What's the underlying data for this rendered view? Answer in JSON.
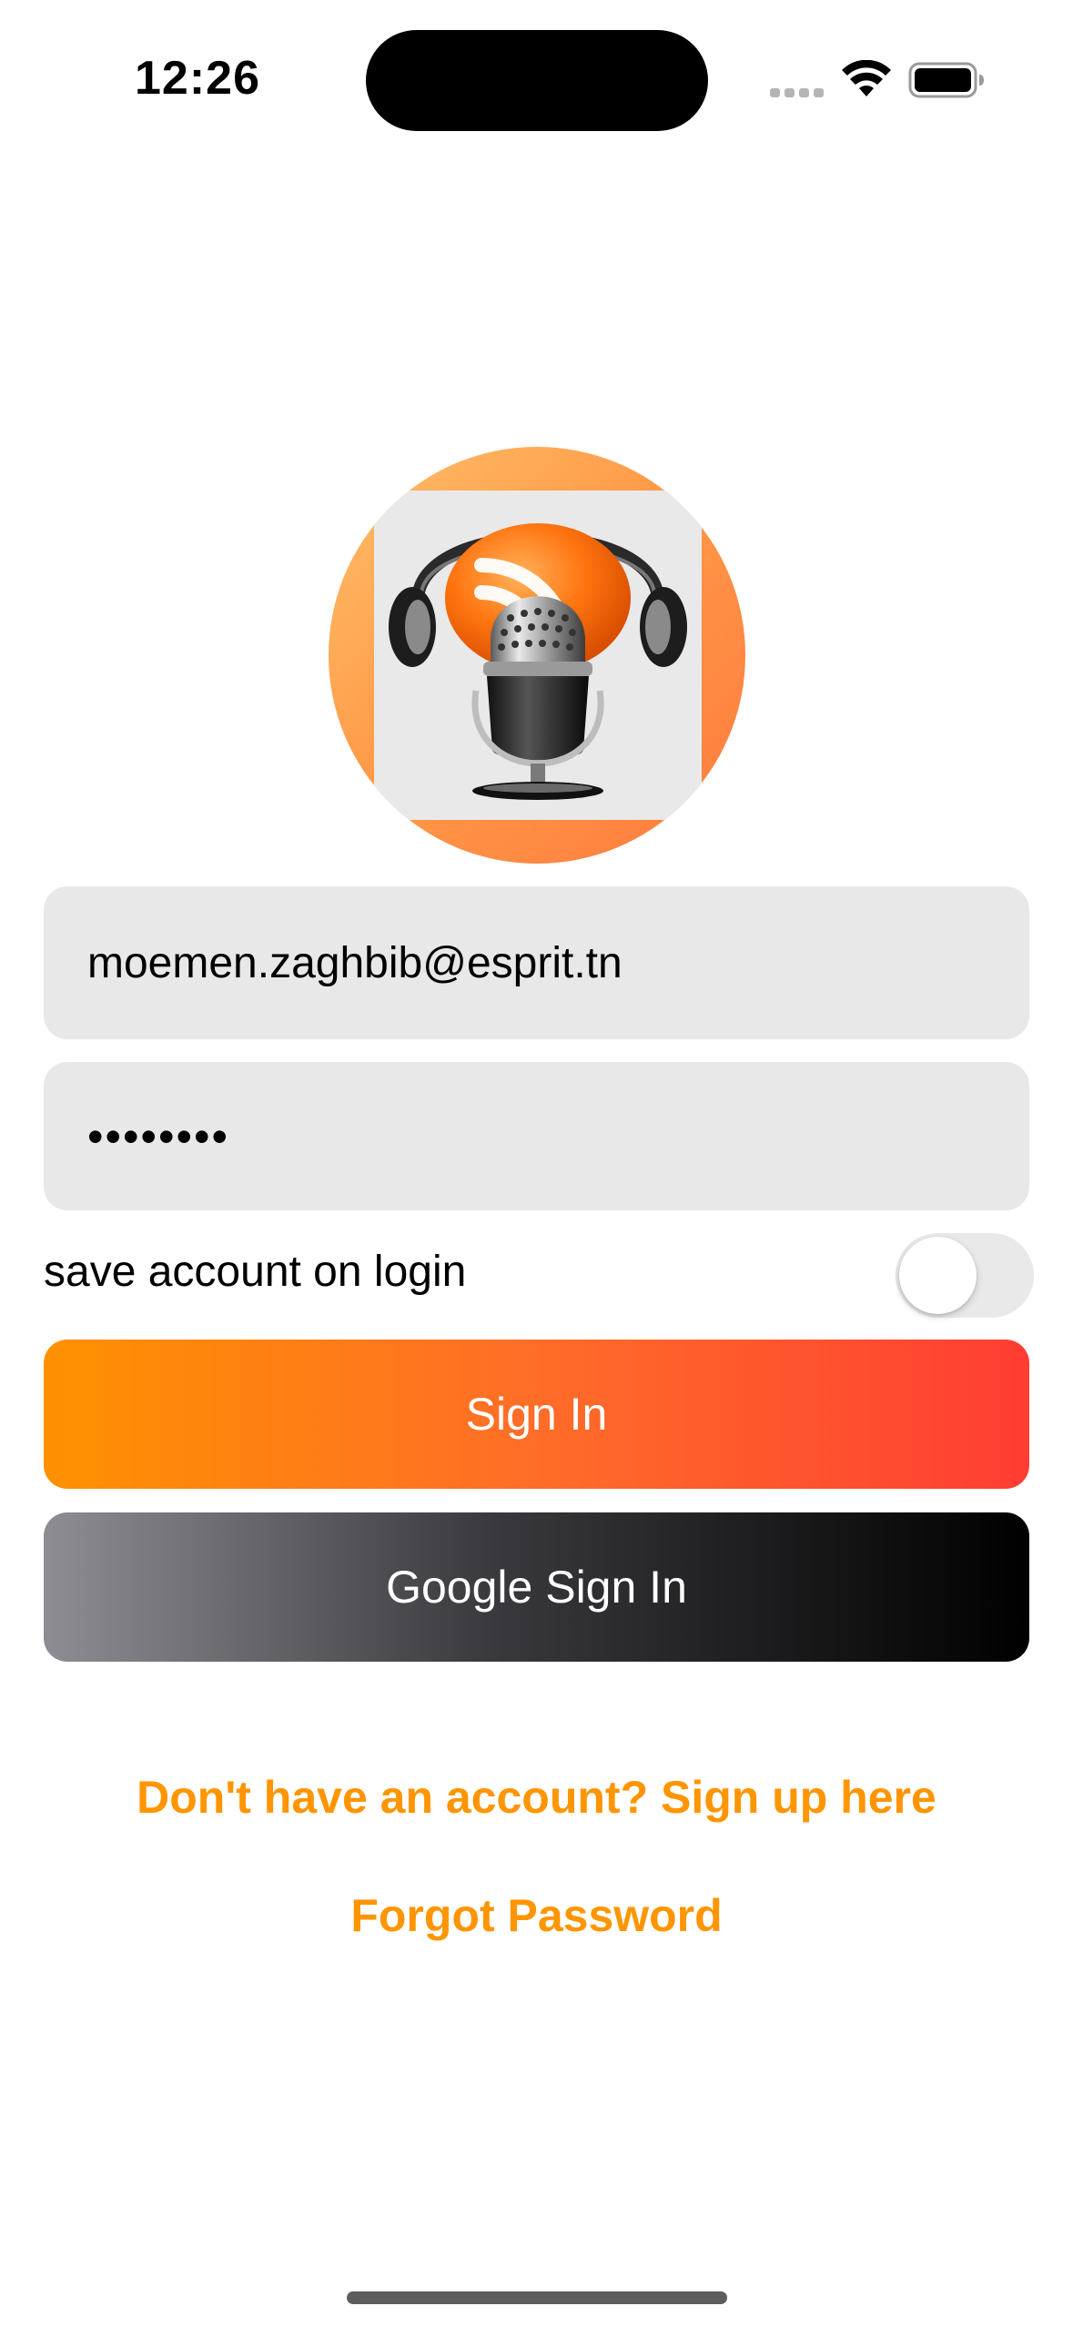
{
  "status_bar": {
    "time": "12:26"
  },
  "icons": {
    "signal": "cellular-signal-icon",
    "wifi": "wifi-icon",
    "battery": "battery-icon",
    "logo": "podcast-microphone-logo"
  },
  "login_form": {
    "email_value": "moemen.zaghbib@esprit.tn",
    "password_masked": "••••••••",
    "save_account_label": "save account on login",
    "save_account_enabled": false,
    "sign_in_label": "Sign In",
    "google_sign_in_label": "Google Sign In"
  },
  "links": {
    "sign_up": "Don't have an account? Sign up here",
    "forgot_password": "Forgot Password"
  },
  "colors": {
    "accent_orange": "#FF9500",
    "sign_in_gradient": [
      "#FF9100",
      "#FF3D33"
    ],
    "google_gradient": [
      "#8E8D93",
      "#000000"
    ],
    "field_background": "#E8E8E8"
  }
}
